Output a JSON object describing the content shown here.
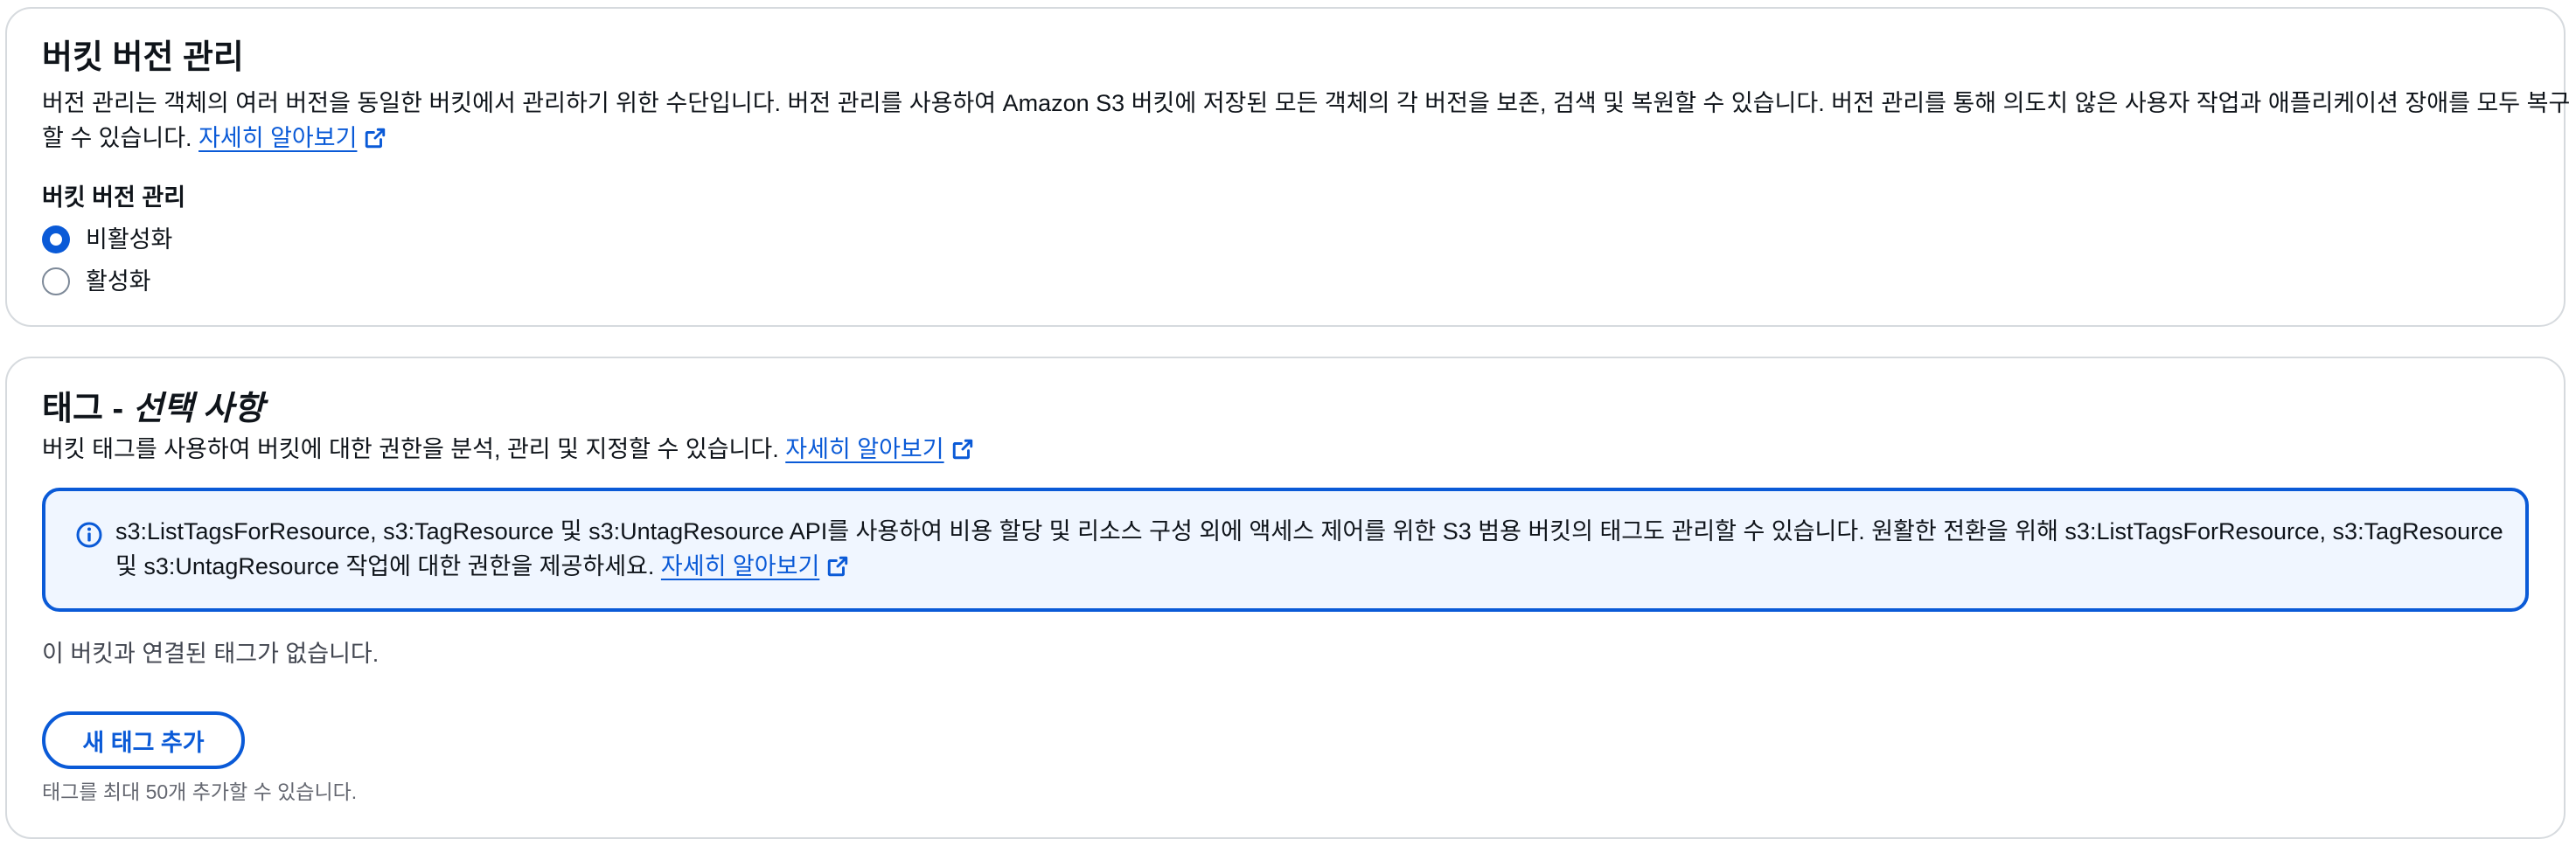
{
  "versioning": {
    "title": "버킷 버전 관리",
    "description_line1": "버전 관리는 객체의 여러 버전을 동일한 버킷에서 관리하기 위한 수단입니다. 버전 관리를 사용하여 Amazon S3 버킷에 저장된 모든 객체의 각 버전을 보존, 검색 및 복원할 수 있습니다. 버전 관리를 통해 의도치 않은 사용자 작업과 애플리케이션 장애를 모두 복구",
    "description_line2": "할 수 있습니다.",
    "learn_more": "자세히 알아보기",
    "field_label": "버킷 버전 관리",
    "options": [
      {
        "label": "비활성화",
        "selected": true
      },
      {
        "label": "활성화",
        "selected": false
      }
    ]
  },
  "tags": {
    "title": "태그 -",
    "title_optional": "선택 사항",
    "description": "버킷 태그를 사용하여 버킷에 대한 권한을 분석, 관리 및 지정할 수 있습니다.",
    "learn_more": "자세히 알아보기",
    "info_line1": "s3:ListTagsForResource, s3:TagResource 및 s3:UntagResource API를 사용하여 비용 할당 및 리소스 구성 외에 액세스 제어를 위한 S3 범용 버킷의 태그도 관리할 수 있습니다. 원활한 전환을 위해 s3:ListTagsForResource, s3:TagResource",
    "info_line2": "및 s3:UntagResource 작업에 대한 권한을 제공하세요.",
    "info_learn_more": "자세히 알아보기",
    "empty_text": "이 버킷과 연결된 태그가 없습니다.",
    "add_button": "새 태그 추가",
    "hint": "태그를 최대 50개 추가할 수 있습니다."
  },
  "colors": {
    "link": "#0a5ad7",
    "info_bg": "#f0f6ff",
    "border": "#d6dade"
  },
  "icons": [
    "external-link-icon",
    "info-icon"
  ]
}
